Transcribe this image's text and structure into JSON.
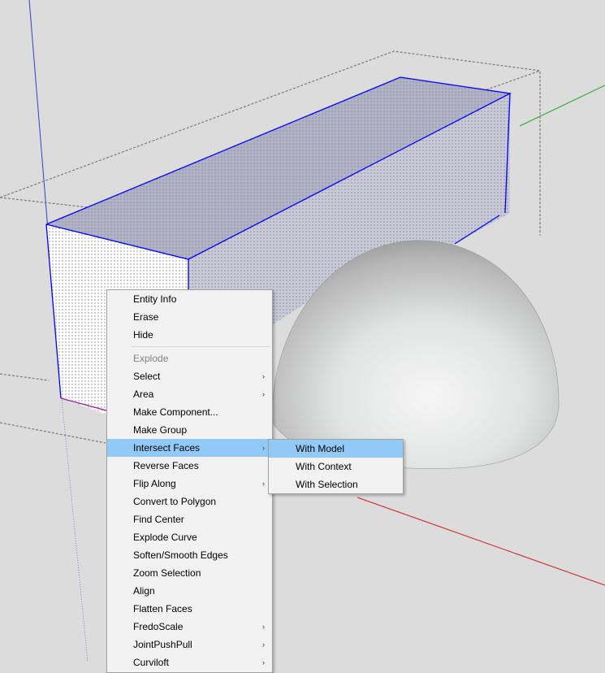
{
  "viewport": {
    "colors": {
      "background": "#dcdcdc",
      "selection_edge": "#0000ff",
      "bounding_box": "#7a7a7a",
      "axis_blue": "#3b3bd0",
      "axis_red": "#cc2020",
      "axis_green": "#22aa22"
    }
  },
  "context_menu": {
    "items": [
      {
        "label": "Entity Info",
        "submenu": false,
        "disabled": false
      },
      {
        "label": "Erase",
        "submenu": false,
        "disabled": false
      },
      {
        "label": "Hide",
        "submenu": false,
        "disabled": false
      },
      {
        "label": "Explode",
        "submenu": false,
        "disabled": true
      },
      {
        "label": "Select",
        "submenu": true,
        "disabled": false
      },
      {
        "label": "Area",
        "submenu": true,
        "disabled": false
      },
      {
        "label": "Make Component...",
        "submenu": false,
        "disabled": false
      },
      {
        "label": "Make Group",
        "submenu": false,
        "disabled": false
      },
      {
        "label": "Intersect Faces",
        "submenu": true,
        "disabled": false,
        "highlighted": true
      },
      {
        "label": "Reverse Faces",
        "submenu": false,
        "disabled": false
      },
      {
        "label": "Flip Along",
        "submenu": true,
        "disabled": false
      },
      {
        "label": "Convert to Polygon",
        "submenu": false,
        "disabled": false
      },
      {
        "label": "Find Center",
        "submenu": false,
        "disabled": false
      },
      {
        "label": "Explode Curve",
        "submenu": false,
        "disabled": false
      },
      {
        "label": "Soften/Smooth Edges",
        "submenu": false,
        "disabled": false
      },
      {
        "label": "Zoom Selection",
        "submenu": false,
        "disabled": false
      },
      {
        "label": "Align",
        "submenu": false,
        "disabled": false
      },
      {
        "label": "Flatten Faces",
        "submenu": false,
        "disabled": false
      },
      {
        "label": "FredoScale",
        "submenu": true,
        "disabled": false
      },
      {
        "label": "JointPushPull",
        "submenu": true,
        "disabled": false
      },
      {
        "label": "Curviloft",
        "submenu": true,
        "disabled": false
      }
    ],
    "arrow_glyph": "›"
  },
  "intersect_submenu": {
    "items": [
      {
        "label": "With Model",
        "highlighted": true
      },
      {
        "label": "With Context",
        "highlighted": false
      },
      {
        "label": "With Selection",
        "highlighted": false
      }
    ]
  },
  "menu_colors": {
    "background": "#f2f2f2",
    "highlight": "#91c9f7",
    "disabled_text": "#838383"
  }
}
